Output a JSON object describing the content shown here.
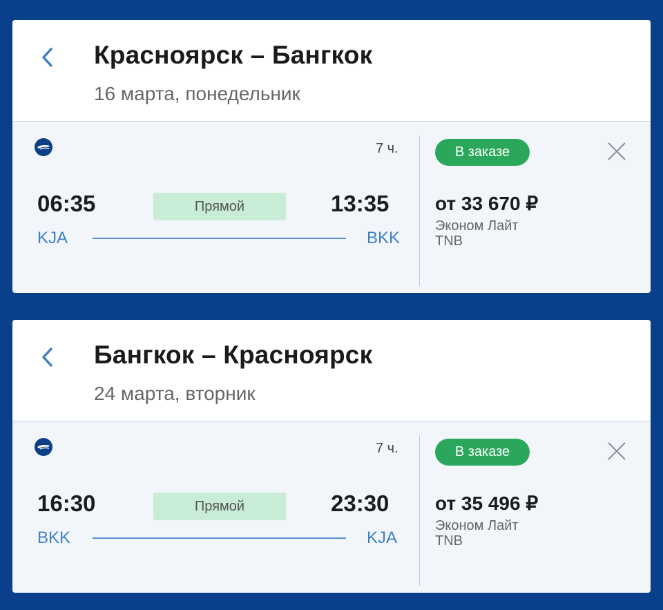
{
  "cards": [
    {
      "title": "Красноярск – Бангкок",
      "date": "16 марта, понедельник",
      "duration": "7 ч.",
      "dep_time": "06:35",
      "arr_time": "13:35",
      "direct": "Прямой",
      "dep_code": "KJA",
      "arr_code": "BKK",
      "status": "В заказе",
      "price": "от 33 670 ₽",
      "fare": "Эконом Лайт",
      "fare_code": "TNB"
    },
    {
      "title": "Бангкок – Красноярск",
      "date": "24 марта, вторник",
      "duration": "7 ч.",
      "dep_time": "16:30",
      "arr_time": "23:30",
      "direct": "Прямой",
      "dep_code": "BKK",
      "arr_code": "KJA",
      "status": "В заказе",
      "price": "от 35 496 ₽",
      "fare": "Эконом Лайт",
      "fare_code": "TNB"
    }
  ],
  "icons": {
    "back": "chevron-left-icon",
    "close": "close-icon",
    "airline": "airline-logo-icon"
  },
  "colors": {
    "background": "#0a3f8c",
    "accent": "#3f7fc4",
    "status_green": "#2aa75a",
    "direct_badge": "#c9ecd7"
  }
}
